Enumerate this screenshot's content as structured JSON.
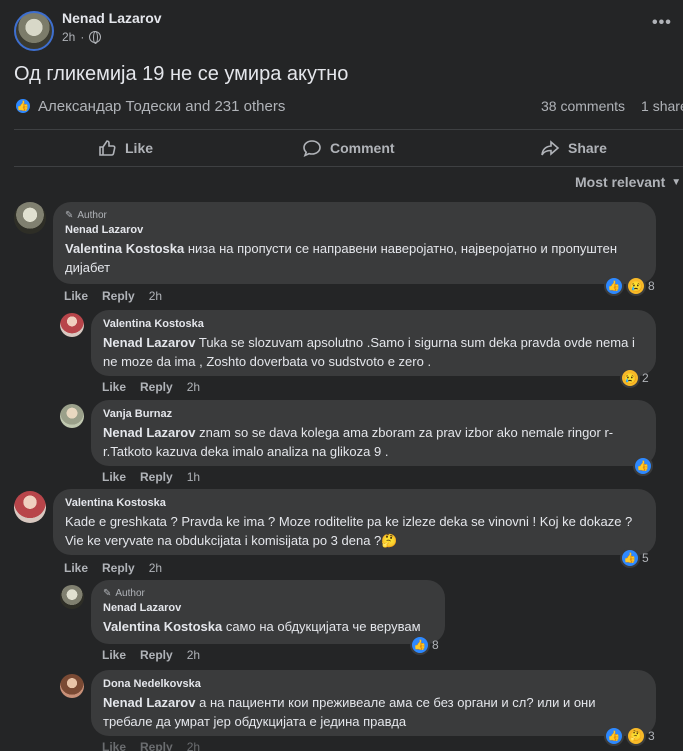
{
  "post": {
    "author": "Nenad Lazarov",
    "time": "2h",
    "text": "Од гликемија 19 не се умира акутно",
    "reactors": "Александар Тодески and 231 others",
    "comments_count": "38 comments",
    "shares_count": "1 share",
    "more_icon": "more-dots-icon"
  },
  "actions": {
    "like": "Like",
    "comment": "Comment",
    "share": "Share"
  },
  "sort": {
    "label": "Most relevant"
  },
  "comments": [
    {
      "author_tag": "Author",
      "name": "Nenad Lazarov",
      "mention": "Valentina Kostoska",
      "text": " низа на пропусти се направени наверојатно, најверојатно и пропуштен дијабет",
      "like": "Like",
      "reply": "Reply",
      "time": "2h",
      "reactions": "8"
    },
    {
      "name": "Valentina Kostoska",
      "mention": "Nenad Lazarov",
      "text": " Tuka se slozuvam apsolutno .Samo i sigurna sum deka pravda ovde nema i ne moze da ima , Zoshto doverbata vo sudstvoto e zero .",
      "like": "Like",
      "reply": "Reply",
      "time": "2h",
      "reactions": "2"
    },
    {
      "name": "Vanja Burnaz",
      "mention": "Nenad Lazarov",
      "text": " znam so se dava kolega ama zboram za prav izbor ako nemale ringor r-r.Tatkoto kazuva deka imalo analiza na glikoza 9 .",
      "like": "Like",
      "reply": "Reply",
      "time": "1h"
    },
    {
      "name": "Valentina Kostoska",
      "text": "Kade e greshkata ? Pravda ke ima ? Moze roditelite pa ke izleze deka se vinovni ! Koj ke dokaze ? Vie ke veryvate na obdukcijata i komisijata po 3 dena ?🤔",
      "like": "Like",
      "reply": "Reply",
      "time": "2h",
      "reactions": "5"
    },
    {
      "author_tag": "Author",
      "name": "Nenad Lazarov",
      "mention": "Valentina Kostoska",
      "text": " само на обдукцијата че верувам",
      "like": "Like",
      "reply": "Reply",
      "time": "2h",
      "reactions": "8"
    },
    {
      "name": "Dona Nedelkovska",
      "mention": "Nenad Lazarov",
      "text": " а на пациенти кои преживеале ама се без органи и сл? или и они требале да умрат јер обдукцијата е јединa правда",
      "like": "Like",
      "reply": "Reply",
      "time": "2h",
      "reactions": "3"
    }
  ],
  "colors": {
    "background": "#242526",
    "bubble": "#3a3b3c",
    "like_blue": "#2e89ff",
    "text": "#e4e6eb",
    "muted": "#b0b3b8"
  }
}
